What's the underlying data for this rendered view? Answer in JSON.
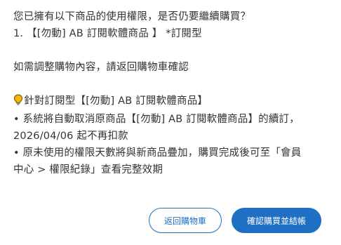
{
  "dialog": {
    "question": "您已擁有以下商品的使用權限，是否仍要繼續購買？",
    "item_line": "1. 【[勿動] AB 訂閱軟體商品 】 *訂閱型",
    "hint": "如需調整購物內容，請返回購物車確認",
    "notice_title": "針對訂閱型【[勿動] AB 訂閱軟體商品】",
    "notice_bullet1_line1": "• 系統將自動取消原商品【[勿動] AB 訂閱軟體商品】的續訂，",
    "notice_bullet1_line2": "2026/04/06 起不再扣款",
    "notice_bullet2_line1": "• 原未使用的權限天數將與新商品疊加，購買完成後可至「會員",
    "notice_bullet2_line2": "中心 > 權限紀錄」查看完整效期"
  },
  "actions": {
    "back_label": "返回購物車",
    "confirm_label": "確認購買並結帳"
  },
  "icons": {
    "notice_icon": "lightbulb-icon"
  },
  "colors": {
    "accent": "#1f6fc5",
    "text": "#333333",
    "bulb": "#f2b705"
  }
}
